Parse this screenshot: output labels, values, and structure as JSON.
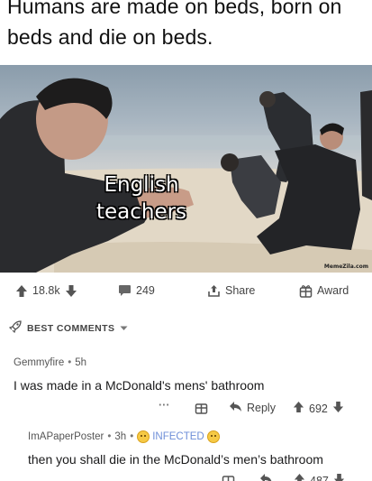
{
  "post": {
    "title": "Humans are made on beds, born on beds and die on beds.",
    "meme_caption_line1": "English",
    "meme_caption_line2": "teachers",
    "watermark": "MemeZila.com"
  },
  "actions": {
    "upvotes": "18.8k",
    "comments": "249",
    "share_label": "Share",
    "award_label": "Award"
  },
  "comments_header": {
    "label": "BEST COMMENTS"
  },
  "comments": [
    {
      "author": "Gemmyfire",
      "time": "5h",
      "text": "I was made in a McDonald's mens' bathroom",
      "more": "···",
      "reply_label": "Reply",
      "score": "692"
    },
    {
      "author": "ImAPaperPoster",
      "time": "3h",
      "flair": "INFECTED",
      "text": "then you shall die in the McDonald’s men’s bathroom",
      "score": "487"
    }
  ],
  "colors": {
    "accent_blue": "#6f8fd8",
    "text_gray": "#444444",
    "emoji_yellow": "#f6c945"
  }
}
